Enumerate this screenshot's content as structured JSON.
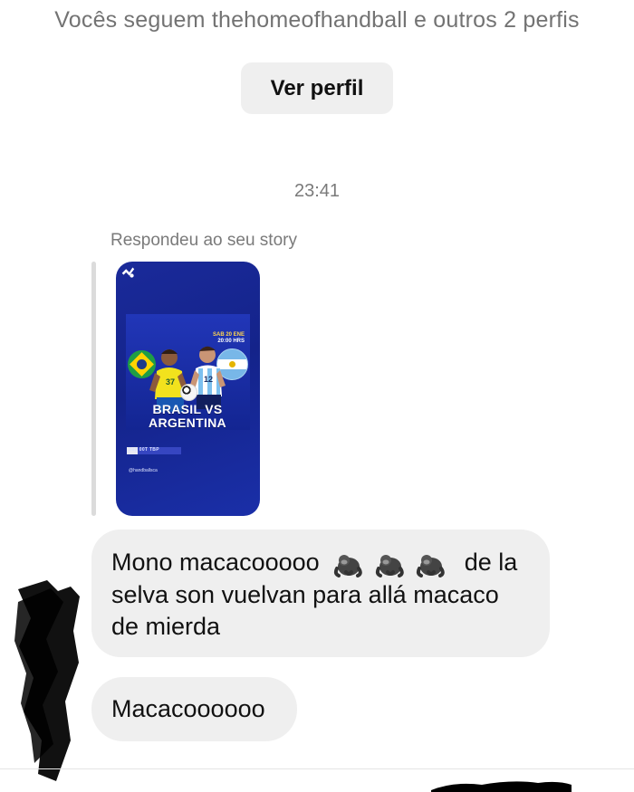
{
  "header": {
    "follow_text": "Vocês seguem thehomeofhandball e outros 2 perfis",
    "view_profile_label": "Ver perfil"
  },
  "thread": {
    "timestamp": "23:41",
    "reply_label": "Respondeu ao seu story",
    "story": {
      "date_text": "SAB 20 ENE",
      "time_text": "20:00 HRS",
      "title_line_1": "BRASIL VS",
      "title_line_2": "ARGENTINA",
      "stripe_text": "Zup   00T   TBP",
      "handle_text": "@handballsca",
      "brand_colors": {
        "story_background": "#1a2a9a",
        "brazil_green": "#1e9e45",
        "brazil_yellow": "#ffd400",
        "argentina_blue": "#78b7e8"
      }
    },
    "messages": [
      {
        "text_before": "Mono macacooooo",
        "emoji_icon": "gorilla-icon",
        "emoji_count": 3,
        "text_after": "de la selva son vuelvan para allá macaco de mierda"
      },
      {
        "text": "Macacoooooo"
      }
    ]
  },
  "ui_colors": {
    "bubble_background": "#efefef",
    "button_background": "#efefef",
    "muted_text": "#737373",
    "reply_bar": "#dbdbdb"
  }
}
